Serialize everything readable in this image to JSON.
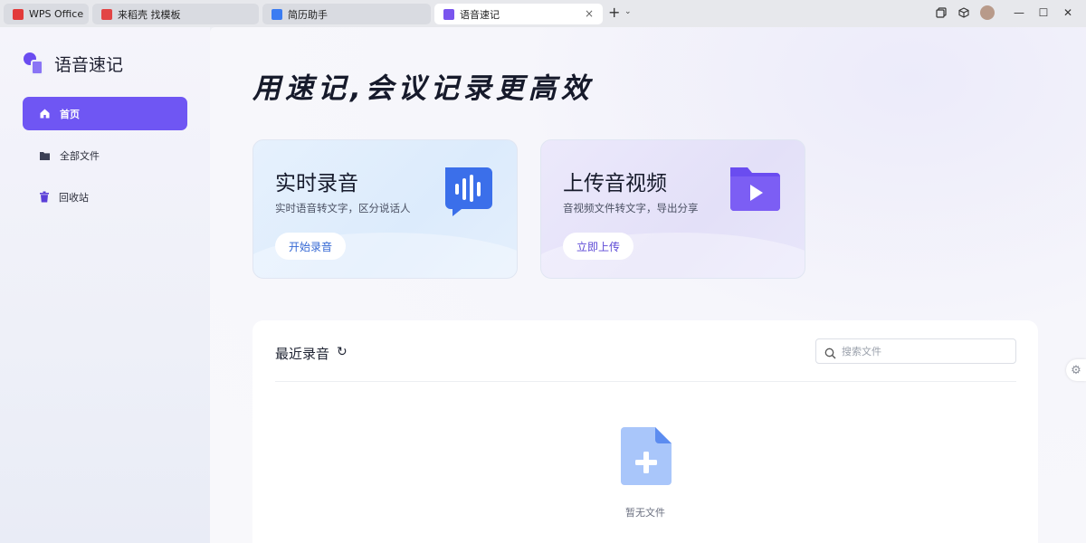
{
  "tabs": [
    {
      "label": "WPS Office",
      "icon": "wps-logo-icon",
      "color": "#e23a3a"
    },
    {
      "label": "来稻壳 找模板",
      "icon": "docer-icon",
      "color": "#e24545"
    },
    {
      "label": "简历助手",
      "icon": "resume-icon",
      "color": "#3b7cf2"
    },
    {
      "label": "语音速记",
      "icon": "voice-note-icon",
      "color": "#7a55ee",
      "active": true
    }
  ],
  "tab_controls": {
    "close": "×",
    "add": "+",
    "more": "⌄"
  },
  "window_controls": {
    "minimize": "—",
    "maximize": "☐",
    "close": "✕"
  },
  "sidebar": {
    "app_name": "语音速记",
    "items": [
      {
        "label": "首页",
        "icon": "home-icon",
        "active": true
      },
      {
        "label": "全部文件",
        "icon": "folder-icon",
        "active": false
      },
      {
        "label": "回收站",
        "icon": "trash-icon",
        "active": false
      }
    ]
  },
  "hero": {
    "title": "用速记,会议记录更高效"
  },
  "cards": {
    "record": {
      "title": "实时录音",
      "subtitle": "实时语音转文字，区分说话人",
      "button": "开始录音",
      "icon": "voice-bubble-icon"
    },
    "upload": {
      "title": "上传音视频",
      "subtitle": "音视频文件转文字，导出分享",
      "button": "立即上传",
      "icon": "video-folder-icon"
    }
  },
  "recent": {
    "title": "最近录音",
    "refresh_icon": "↻",
    "search_placeholder": "搜索文件",
    "empty_text": "暂无文件"
  },
  "colors": {
    "accent": "#6f56f3",
    "record_blue": "#3b6fea",
    "upload_purple": "#6a4cf0"
  }
}
